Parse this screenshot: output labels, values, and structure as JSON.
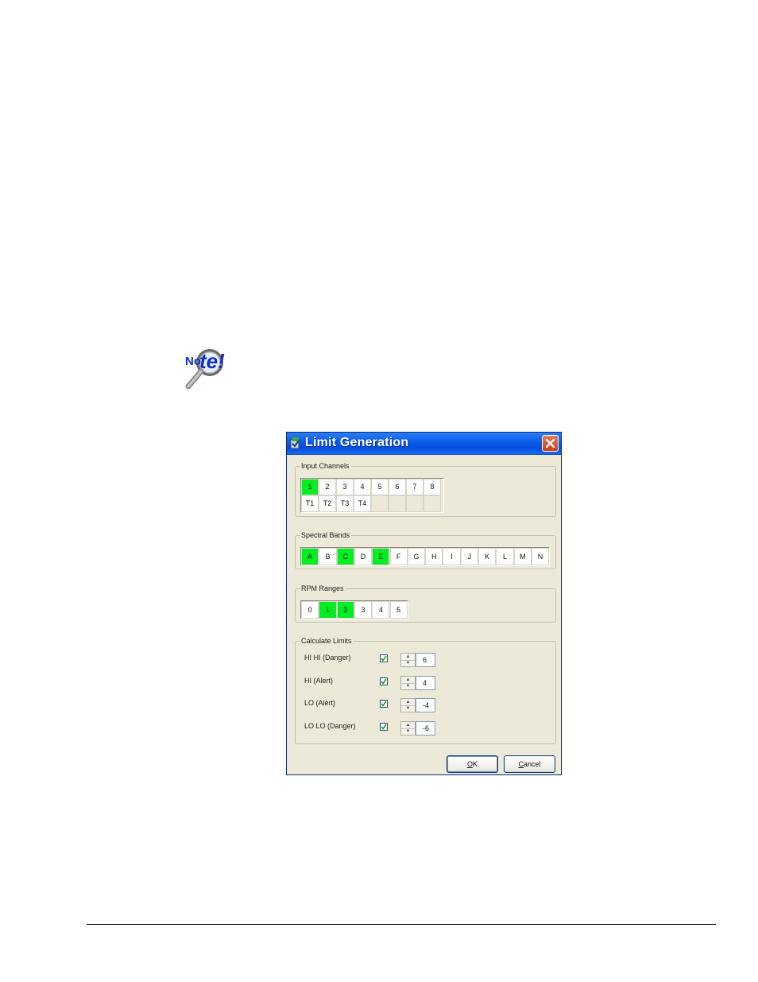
{
  "window": {
    "title": "Limit Generation",
    "close_label": "×"
  },
  "input_channels": {
    "label": "Input Channels",
    "row1": [
      {
        "label": "1",
        "on": true
      },
      {
        "label": "2",
        "on": false
      },
      {
        "label": "3",
        "on": false
      },
      {
        "label": "4",
        "on": false
      },
      {
        "label": "5",
        "on": false
      },
      {
        "label": "6",
        "on": false
      },
      {
        "label": "7",
        "on": false
      },
      {
        "label": "8",
        "on": false
      }
    ],
    "row2": [
      {
        "label": "T1",
        "on": false
      },
      {
        "label": "T2",
        "on": false
      },
      {
        "label": "T3",
        "on": false
      },
      {
        "label": "T4",
        "on": false
      }
    ]
  },
  "spectral_bands": {
    "label": "Spectral Bands",
    "items": [
      {
        "label": "A",
        "on": true
      },
      {
        "label": "B",
        "on": false
      },
      {
        "label": "C",
        "on": true
      },
      {
        "label": "D",
        "on": false
      },
      {
        "label": "E",
        "on": true
      },
      {
        "label": "F",
        "on": false
      },
      {
        "label": "G",
        "on": false
      },
      {
        "label": "H",
        "on": false
      },
      {
        "label": "I",
        "on": false
      },
      {
        "label": "J",
        "on": false
      },
      {
        "label": "K",
        "on": false
      },
      {
        "label": "L",
        "on": false
      },
      {
        "label": "M",
        "on": false
      },
      {
        "label": "N",
        "on": false
      }
    ]
  },
  "rpm_ranges": {
    "label": "RPM Ranges",
    "items": [
      {
        "label": "0",
        "on": false
      },
      {
        "label": "1",
        "on": true
      },
      {
        "label": "2",
        "on": true
      },
      {
        "label": "3",
        "on": false
      },
      {
        "label": "4",
        "on": false
      },
      {
        "label": "5",
        "on": false
      }
    ]
  },
  "calculate_limits": {
    "label": "Calculate Limits",
    "rows": [
      {
        "label": "HI HI  (Danger)",
        "checked": true,
        "value": "6"
      },
      {
        "label": "HI  (Alert)",
        "checked": true,
        "value": "4"
      },
      {
        "label": "LO  (Alert)",
        "checked": true,
        "value": "-4"
      },
      {
        "label": "LO LO  (Danger)",
        "checked": true,
        "value": "-6"
      }
    ]
  },
  "buttons": {
    "ok_mnemonic": "O",
    "ok_rest": "K",
    "cancel_mnemonic": "C",
    "cancel_rest": "ancel"
  },
  "colors": {
    "selected": "#00ee22",
    "titlebar": "#0a5ce6",
    "face": "#ece9d8"
  }
}
